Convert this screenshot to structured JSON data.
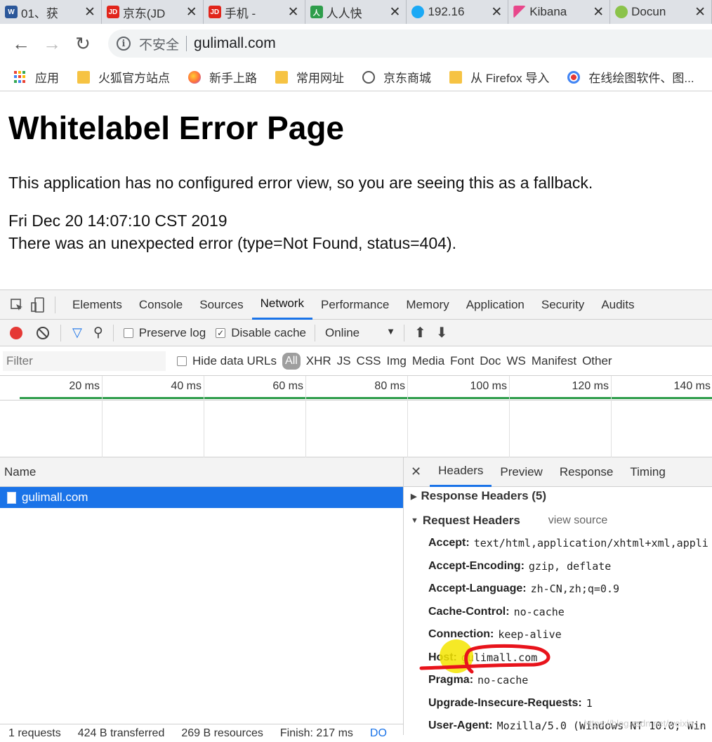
{
  "tabs": [
    {
      "title": "01、获",
      "icon": "word-icon",
      "icon_text": "W",
      "color": "#2b579a"
    },
    {
      "title": "京东(JD",
      "icon": "jd-icon",
      "icon_text": "JD",
      "color": "#e1251b"
    },
    {
      "title": "手机 -",
      "icon": "jd-icon",
      "icon_text": "JD",
      "color": "#e1251b"
    },
    {
      "title": "人人快",
      "icon": "renren-icon",
      "icon_text": "人",
      "color": "#2e9d4b"
    },
    {
      "title": "192.16",
      "icon": "elastic-icon",
      "icon_text": "",
      "color": "#1ba9f5"
    },
    {
      "title": "Kibana",
      "icon": "kibana-icon",
      "icon_text": "",
      "color": "#e8478b"
    },
    {
      "title": "Docun",
      "icon": "spring-icon",
      "icon_text": "",
      "color": "#8bc34a"
    }
  ],
  "tab_close_glyph": "✕",
  "address": {
    "security_label": "不安全",
    "url": "gulimall.com"
  },
  "bookmarks": [
    {
      "label": "应用",
      "icon": "apps-icon"
    },
    {
      "label": "火狐官方站点",
      "icon": "folder-icon"
    },
    {
      "label": "新手上路",
      "icon": "firefox-icon"
    },
    {
      "label": "常用网址",
      "icon": "folder-icon"
    },
    {
      "label": "京东商城",
      "icon": "globe-icon"
    },
    {
      "label": "从 Firefox 导入",
      "icon": "folder-icon"
    },
    {
      "label": "在线绘图软件、图...",
      "icon": "processon-icon"
    }
  ],
  "page": {
    "title": "Whitelabel Error Page",
    "message": "This application has no configured error view, so you are seeing this as a fallback.",
    "timestamp": "Fri Dec 20 14:07:10 CST 2019",
    "error": "There was an unexpected error (type=Not Found, status=404)."
  },
  "devtools": {
    "tabs": [
      "Elements",
      "Console",
      "Sources",
      "Network",
      "Performance",
      "Memory",
      "Application",
      "Security",
      "Audits"
    ],
    "active_tab": "Network",
    "toolbar": {
      "preserve_log": "Preserve log",
      "disable_cache": "Disable cache",
      "throttling": "Online"
    },
    "filter_placeholder": "Filter",
    "hide_data_urls": "Hide data URLs",
    "types": [
      "All",
      "XHR",
      "JS",
      "CSS",
      "Img",
      "Media",
      "Font",
      "Doc",
      "WS",
      "Manifest",
      "Other"
    ],
    "timeline_ticks": [
      "20 ms",
      "40 ms",
      "60 ms",
      "80 ms",
      "100 ms",
      "120 ms",
      "140 ms"
    ],
    "name_column": "Name",
    "requests": [
      "gulimall.com"
    ],
    "status_bar": [
      "1 requests",
      "424 B transferred",
      "269 B resources",
      "Finish: 217 ms",
      "DO"
    ],
    "detail_tabs": [
      "Headers",
      "Preview",
      "Response",
      "Timing"
    ],
    "response_headers_label": "Response Headers (5)",
    "request_headers_label": "Request Headers",
    "view_source": "view source",
    "request_headers": [
      {
        "key": "Accept:",
        "value": "text/html,application/xhtml+xml,appli"
      },
      {
        "key": "Accept-Encoding:",
        "value": "gzip, deflate"
      },
      {
        "key": "Accept-Language:",
        "value": "zh-CN,zh;q=0.9"
      },
      {
        "key": "Cache-Control:",
        "value": "no-cache"
      },
      {
        "key": "Connection:",
        "value": "keep-alive"
      },
      {
        "key": "Host:",
        "value": "gulimall.com"
      },
      {
        "key": "Pragma:",
        "value": "no-cache"
      },
      {
        "key": "Upgrade-Insecure-Requests:",
        "value": "1"
      },
      {
        "key": "User-Agent:",
        "value": "Mozilla/5.0 (Windows NT 10.0; Win"
      }
    ]
  },
  "watermark": "https://blog.csdn.net/weixin_..."
}
